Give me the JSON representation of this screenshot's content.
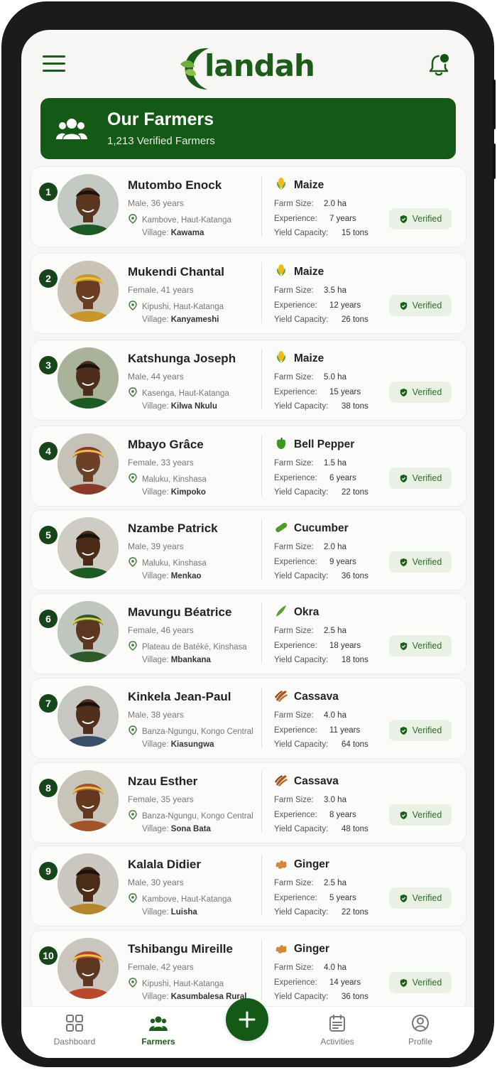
{
  "app": {
    "logo_text": "landah"
  },
  "colors": {
    "brand_green": "#145a16",
    "accent": "#1d5c1a",
    "verified_bg": "#e8f1e4"
  },
  "header": {
    "menu_icon": "hamburger-menu-icon",
    "notification_icon": "bell-icon",
    "has_unread": true
  },
  "banner": {
    "title": "Our Farmers",
    "subtitle": "1,213 Verified Farmers",
    "icon": "users-group-icon"
  },
  "labels": {
    "farm_size": "Farm Size:",
    "experience": "Experience:",
    "yield": "Yield Capacity:",
    "village": "Village:",
    "verified": "Verified"
  },
  "farmers": [
    {
      "rank": "1",
      "name": "Mutombo Enock",
      "demo": "Male, 36 years",
      "location": "Kambove, Haut-Katanga",
      "village": "Kawama",
      "crop": "Maize",
      "crop_icon": "corn",
      "farm_size": "2.0 ha",
      "experience": "7 years",
      "yield": "15 tons"
    },
    {
      "rank": "2",
      "name": "Mukendi Chantal",
      "demo": "Female, 41 years",
      "location": "Kipushi, Haut-Katanga",
      "village": "Kanyameshi",
      "crop": "Maize",
      "crop_icon": "corn",
      "farm_size": "3.5 ha",
      "experience": "12 years",
      "yield": "26 tons"
    },
    {
      "rank": "3",
      "name": "Katshunga Joseph",
      "demo": "Male, 44 years",
      "location": "Kasenga, Haut-Katanga",
      "village": "Kilwa Nkulu",
      "crop": "Maize",
      "crop_icon": "corn",
      "farm_size": "5.0 ha",
      "experience": "15 years",
      "yield": "38 tons"
    },
    {
      "rank": "4",
      "name": "Mbayo Grâce",
      "demo": "Female, 33 years",
      "location": "Maluku, Kinshasa",
      "village": "Kimpoko",
      "crop": "Bell Pepper",
      "crop_icon": "pepper",
      "farm_size": "1.5 ha",
      "experience": "6 years",
      "yield": "22 tons"
    },
    {
      "rank": "5",
      "name": "Nzambe Patrick",
      "demo": "Male, 39 years",
      "location": "Maluku, Kinshasa",
      "village": "Menkao",
      "crop": "Cucumber",
      "crop_icon": "cucumber",
      "farm_size": "2.0 ha",
      "experience": "9 years",
      "yield": "36 tons"
    },
    {
      "rank": "6",
      "name": "Mavungu Béatrice",
      "demo": "Female, 46 years",
      "location": "Plateau de Batéké, Kinshasa",
      "village": "Mbankana",
      "crop": "Okra",
      "crop_icon": "okra",
      "farm_size": "2.5 ha",
      "experience": "18 years",
      "yield": "18 tons"
    },
    {
      "rank": "7",
      "name": "Kinkela Jean-Paul",
      "demo": "Male, 38 years",
      "location": "Banza-Ngungu, Kongo Central",
      "village": "Kiasungwa",
      "crop": "Cassava",
      "crop_icon": "cassava",
      "farm_size": "4.0 ha",
      "experience": "11 years",
      "yield": "64 tons"
    },
    {
      "rank": "8",
      "name": "Nzau Esther",
      "demo": "Female, 35 years",
      "location": "Banza-Ngungu, Kongo Central",
      "village": "Sona Bata",
      "crop": "Cassava",
      "crop_icon": "cassava",
      "farm_size": "3.0 ha",
      "experience": "8 years",
      "yield": "48 tons"
    },
    {
      "rank": "9",
      "name": "Kalala Didier",
      "demo": "Male, 30 years",
      "location": "Kambove, Haut-Katanga",
      "village": "Luisha",
      "crop": "Ginger",
      "crop_icon": "ginger",
      "farm_size": "2.5 ha",
      "experience": "5 years",
      "yield": "22 tons"
    },
    {
      "rank": "10",
      "name": "Tshibangu Mireille",
      "demo": "Female, 42 years",
      "location": "Kipushi, Haut-Katanga",
      "village": "Kasumbalesa Rural",
      "crop": "Ginger",
      "crop_icon": "ginger",
      "farm_size": "4.0 ha",
      "experience": "14 years",
      "yield": "36 tons"
    }
  ],
  "bottom_nav": [
    {
      "label": "Dashboard",
      "icon": "grid-icon",
      "active": false
    },
    {
      "label": "Farmers",
      "icon": "users-icon",
      "active": true
    },
    {
      "label": "",
      "icon": "plus-icon",
      "active": false
    },
    {
      "label": "Activities",
      "icon": "calendar-icon",
      "active": false
    },
    {
      "label": "Profile",
      "icon": "profile-icon",
      "active": false
    }
  ]
}
